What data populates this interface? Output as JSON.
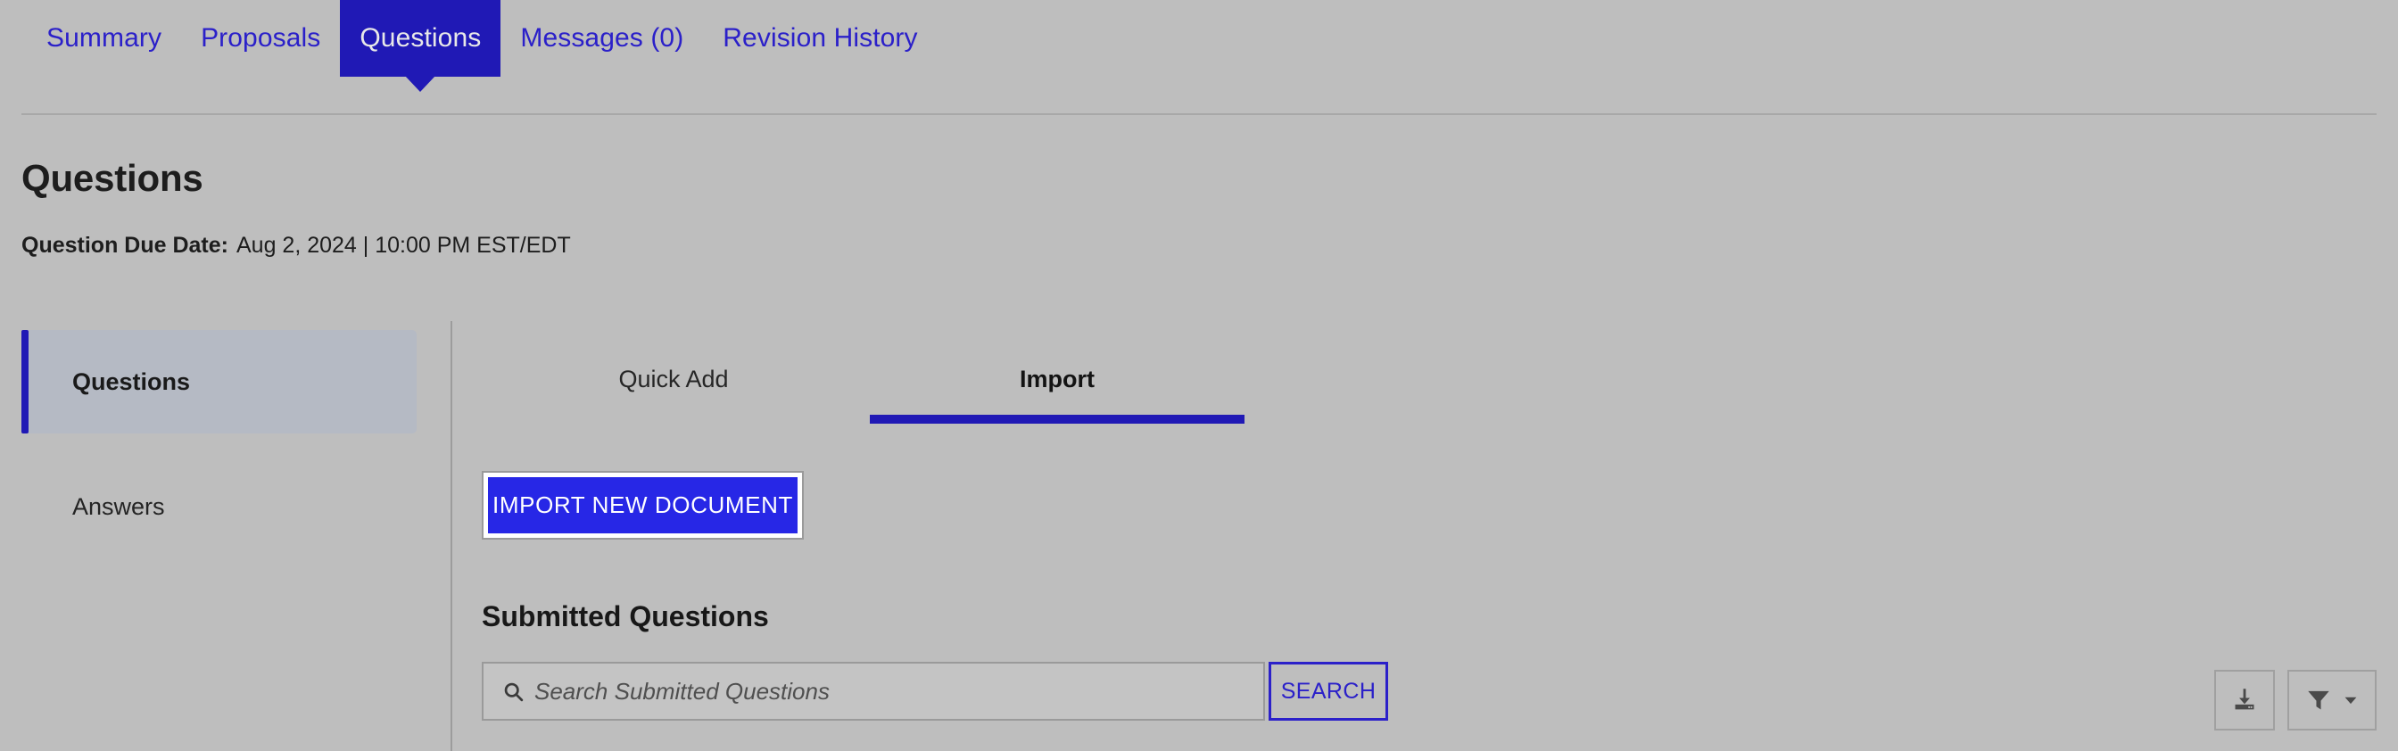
{
  "top_nav": {
    "tabs": [
      {
        "label": "Summary",
        "active": false
      },
      {
        "label": "Proposals",
        "active": false
      },
      {
        "label": "Questions",
        "active": true
      },
      {
        "label": "Messages (0)",
        "active": false
      },
      {
        "label": "Revision History",
        "active": false
      }
    ]
  },
  "page": {
    "title": "Questions",
    "due_label": "Question Due Date:",
    "due_value": "Aug 2, 2024 | 10:00 PM EST/EDT"
  },
  "sidebar": {
    "items": [
      {
        "label": "Questions",
        "active": true
      },
      {
        "label": "Answers",
        "active": false
      }
    ]
  },
  "main": {
    "tabs": [
      {
        "label": "Quick Add",
        "active": false
      },
      {
        "label": "Import",
        "active": true
      }
    ],
    "import_button_label": "IMPORT NEW DOCUMENT",
    "section_title": "Submitted Questions",
    "search": {
      "placeholder": "Search Submitted Questions",
      "value": "",
      "button_label": "SEARCH",
      "icon": "search-icon"
    },
    "actions": [
      {
        "icon": "download-icon",
        "has_chevron": false
      },
      {
        "icon": "filter-icon",
        "has_chevron": true
      }
    ]
  },
  "colors": {
    "page_background": "#bebebe",
    "accent_blue": "#2019b5",
    "link_blue": "#2b20c9",
    "button_blue": "#2727e6",
    "active_sidebar_bg": "#b5bac4",
    "divider": "#9c9c9c",
    "text_dark": "#1d1d1d"
  }
}
